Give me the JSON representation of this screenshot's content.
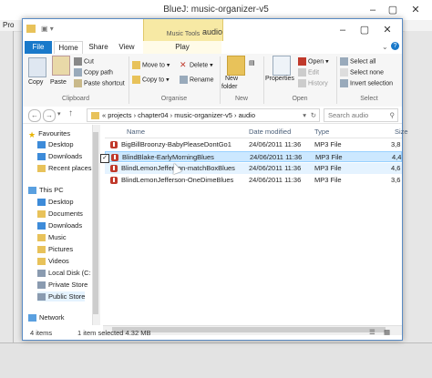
{
  "bluej": {
    "title": "BlueJ:  music-organizer-v5",
    "menu_partial": "Pro"
  },
  "explorer": {
    "title": "audio",
    "contextual_tab": "Music Tools",
    "tabs": [
      "File",
      "Home",
      "Share",
      "View",
      "Play"
    ],
    "ribbon": {
      "clipboard": {
        "copy": "Copy",
        "paste": "Paste",
        "cut": "Cut",
        "copy_path": "Copy path",
        "paste_shortcut": "Paste shortcut",
        "label": "Clipboard"
      },
      "organise": {
        "move_to": "Move to",
        "copy_to": "Copy to",
        "delete": "Delete",
        "rename": "Rename",
        "label": "Organise"
      },
      "new": {
        "new_folder_1": "New",
        "new_folder_2": "folder",
        "label": "New"
      },
      "open": {
        "properties": "Properties",
        "open": "Open",
        "edit": "Edit",
        "history": "History",
        "label": "Open"
      },
      "select": {
        "select_all": "Select all",
        "select_none": "Select none",
        "invert_selection": "Invert selection",
        "label": "Select"
      }
    },
    "address": {
      "crumbs": "«  projects  ›  chapter04  ›  music-organizer-v5  ›  audio",
      "search_placeholder": "Search audio"
    },
    "nav": {
      "favourites": "Favourites",
      "desktop": "Desktop",
      "downloads": "Downloads",
      "recent": "Recent places",
      "this_pc": "This PC",
      "pc_desktop": "Desktop",
      "documents": "Documents",
      "pc_downloads": "Downloads",
      "music": "Music",
      "pictures": "Pictures",
      "videos": "Videos",
      "local_disk": "Local Disk (C:",
      "private_store": "Private Store",
      "public_store": "Public Store",
      "network": "Network"
    },
    "columns": {
      "name": "Name",
      "date": "Date modified",
      "type": "Type",
      "size": "Size"
    },
    "files": [
      {
        "name": "BigBillBroonzy-BabyPleaseDontGo1",
        "date": "24/06/2011 11:36",
        "type": "MP3 File",
        "size": "3,8"
      },
      {
        "name": "BlindBlake-EarlyMorningBlues",
        "date": "24/06/2011 11:36",
        "type": "MP3 File",
        "size": "4,4"
      },
      {
        "name": "BlindLemonJefferson-matchBoxBlues",
        "date": "24/06/2011 11:36",
        "type": "MP3 File",
        "size": "4,6"
      },
      {
        "name": "BlindLemonJefferson-OneDimeBlues",
        "date": "24/06/2011 11:36",
        "type": "MP3 File",
        "size": "3,6"
      }
    ],
    "status": {
      "items": "4 items",
      "selected": "1 item selected  4.32 MB"
    }
  },
  "colors": {
    "accent": "#1979ca",
    "selection": "#cce8ff",
    "music_tools": "#f7e9a4"
  }
}
